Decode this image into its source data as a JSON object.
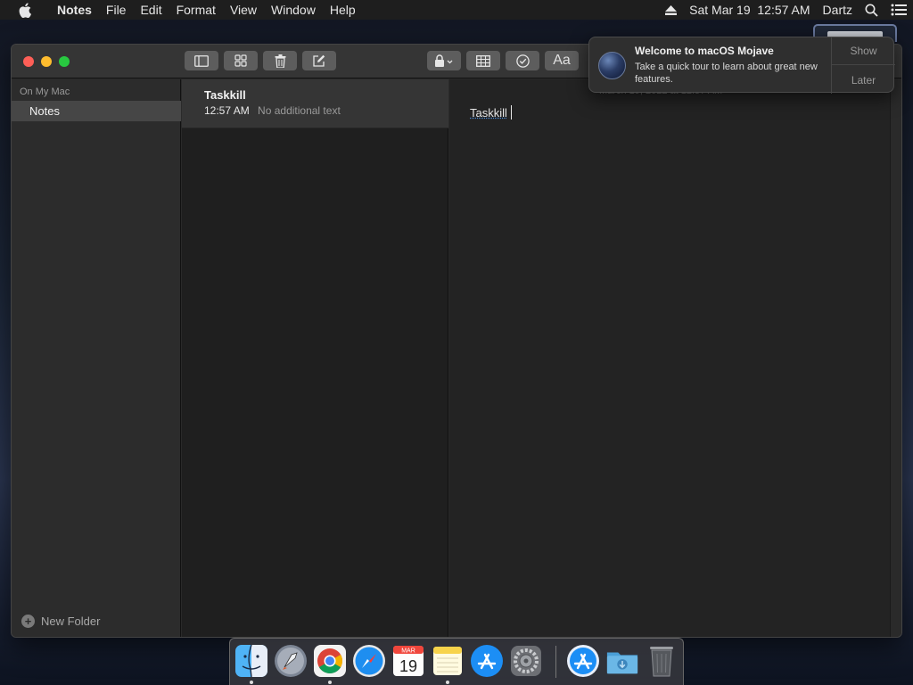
{
  "menubar": {
    "apple_icon": "apple-icon",
    "app_name": "Notes",
    "items": [
      "File",
      "Edit",
      "Format",
      "View",
      "Window",
      "Help"
    ],
    "datetime": "Sat Mar 19  12:57 AM",
    "user": "Dartz"
  },
  "window": {
    "sidebar": {
      "section": "On My Mac",
      "folder": "Notes",
      "new_folder": "New Folder"
    },
    "note_list": {
      "notes": [
        {
          "title": "Taskkill",
          "time": "12:57 AM",
          "preview": "No additional text"
        }
      ]
    },
    "editor": {
      "date": "March 19, 2022 at 12:57 AM",
      "text": "Taskkill"
    }
  },
  "notification": {
    "title": "Welcome to macOS Mojave",
    "message": "Take a quick tour to learn about great new features.",
    "show": "Show",
    "later": "Later"
  },
  "dock": {
    "items": [
      "finder",
      "launchpad",
      "chrome",
      "safari",
      "calendar",
      "notes",
      "app-store",
      "system-preferences",
      "app-store",
      "downloads",
      "trash"
    ],
    "calendar_month": "MAR",
    "calendar_day": "19"
  },
  "colors": {
    "accent": "#4a8bd6",
    "close": "#fe5f57",
    "minimize": "#febc2e",
    "zoom": "#28c840"
  }
}
